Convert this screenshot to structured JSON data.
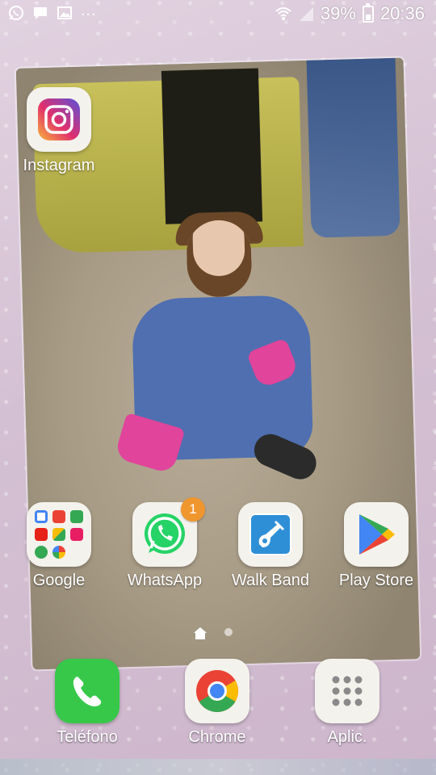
{
  "status_bar": {
    "notification_icons": [
      "whatsapp-icon",
      "message-icon",
      "gallery-icon"
    ],
    "more": "...",
    "battery": "39%",
    "time": "20:36"
  },
  "home": {
    "instagram": {
      "label": "Instagram"
    },
    "apps": [
      {
        "label": "Google"
      },
      {
        "label": "WhatsApp",
        "badge": "1"
      },
      {
        "label": "Walk Band"
      },
      {
        "label": "Play Store"
      }
    ]
  },
  "pager": {
    "pages": 2,
    "current": 1
  },
  "dock": [
    {
      "label": "Teléfono"
    },
    {
      "label": "Chrome"
    },
    {
      "label": "Aplic."
    }
  ],
  "colors": {
    "whatsapp": "#25d366",
    "badge": "#f0962e",
    "phone": "#37c84a",
    "walkband": "#2f8fd6"
  }
}
